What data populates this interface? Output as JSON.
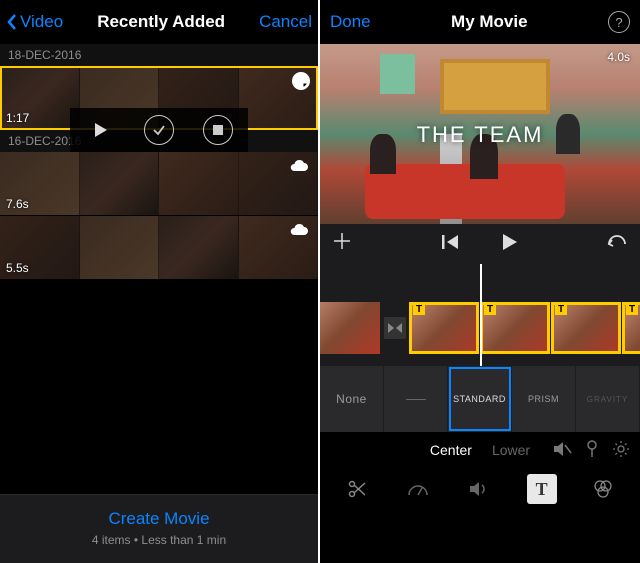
{
  "left": {
    "nav": {
      "back": "Video",
      "title": "Recently Added",
      "cancel": "Cancel"
    },
    "sections": [
      {
        "date": "18-DEC-2016",
        "clips": [
          {
            "duration": "1:17",
            "selected": true,
            "badge": "clock"
          }
        ]
      },
      {
        "date": "16-DEC-2016",
        "clips": [
          {
            "duration": "7.6s",
            "badge": "cloud"
          },
          {
            "duration": "5.5s",
            "badge": "cloud"
          }
        ]
      }
    ],
    "footer": {
      "label": "Create Movie",
      "sub": "4 items • Less than 1 min"
    }
  },
  "right": {
    "nav": {
      "done": "Done",
      "title": "My Movie"
    },
    "preview": {
      "timecode": "4.0s",
      "overlay_title": "THE TEAM"
    },
    "title_styles": {
      "options": [
        "None",
        "—",
        "STANDARD",
        "PRISM",
        "GRAVITY"
      ],
      "selected_index": 2
    },
    "text_position": {
      "center": "Center",
      "lower": "Lower",
      "active": "center"
    },
    "tools": {
      "text_label": "T"
    }
  }
}
